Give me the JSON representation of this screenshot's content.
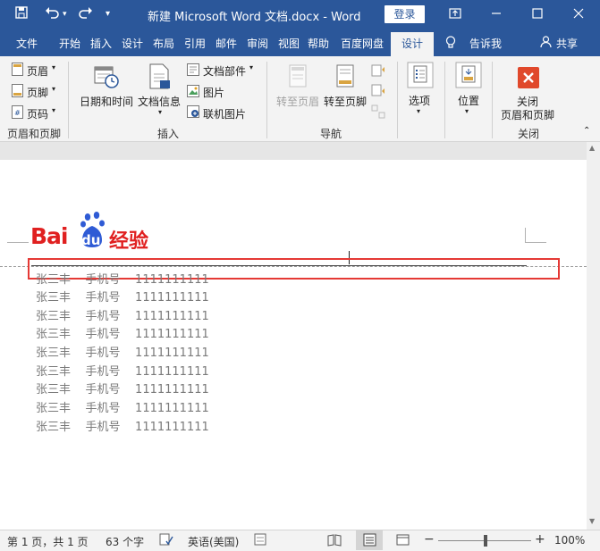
{
  "title_bar": {
    "document_title": "新建 Microsoft Word 文档.docx  -  Word",
    "login_label": "登录"
  },
  "tabs": [
    {
      "label": "文件"
    },
    {
      "label": "开始"
    },
    {
      "label": "插入"
    },
    {
      "label": "设计"
    },
    {
      "label": "布局"
    },
    {
      "label": "引用"
    },
    {
      "label": "邮件"
    },
    {
      "label": "审阅"
    },
    {
      "label": "视图"
    },
    {
      "label": "帮助"
    },
    {
      "label": "百度网盘"
    },
    {
      "label": "设计"
    }
  ],
  "tell_me": "告诉我",
  "share": "共享",
  "ribbon": {
    "header_footer": {
      "header": "页眉",
      "footer": "页脚",
      "page_number": "页码",
      "group": "页眉和页脚"
    },
    "insert": {
      "date_time": "日期和时间",
      "doc_info": "文档信息",
      "doc_parts": "文档部件",
      "picture": "图片",
      "online_picture": "联机图片",
      "group": "插入"
    },
    "navigation": {
      "goto_header": "转至页眉",
      "goto_footer": "转至页脚",
      "group": "导航"
    },
    "options": {
      "label": "选项"
    },
    "position": {
      "label": "位置"
    },
    "close": {
      "label_line1": "关闭",
      "label_line2": "页眉和页脚",
      "group": "关闭"
    }
  },
  "document": {
    "logo_text_bai": "Bai",
    "logo_text_du": "du",
    "logo_text_jingyan": "经验",
    "rows": [
      "张三丰    手机号    1111111111",
      "张三丰    手机号    1111111111",
      "张三丰    手机号    1111111111",
      "张三丰    手机号    1111111111",
      "张三丰    手机号    1111111111",
      "张三丰    手机号    1111111111",
      "张三丰    手机号    1111111111",
      "张三丰    手机号    1111111111",
      "张三丰    手机号    1111111111"
    ]
  },
  "status_bar": {
    "page": "第 1 页，共 1 页",
    "words": "63 个字",
    "language": "英语(美国)",
    "zoom": "100%"
  },
  "colors": {
    "title_blue": "#2b579a",
    "highlight_red": "#e53935",
    "close_red": "#e0482b"
  }
}
